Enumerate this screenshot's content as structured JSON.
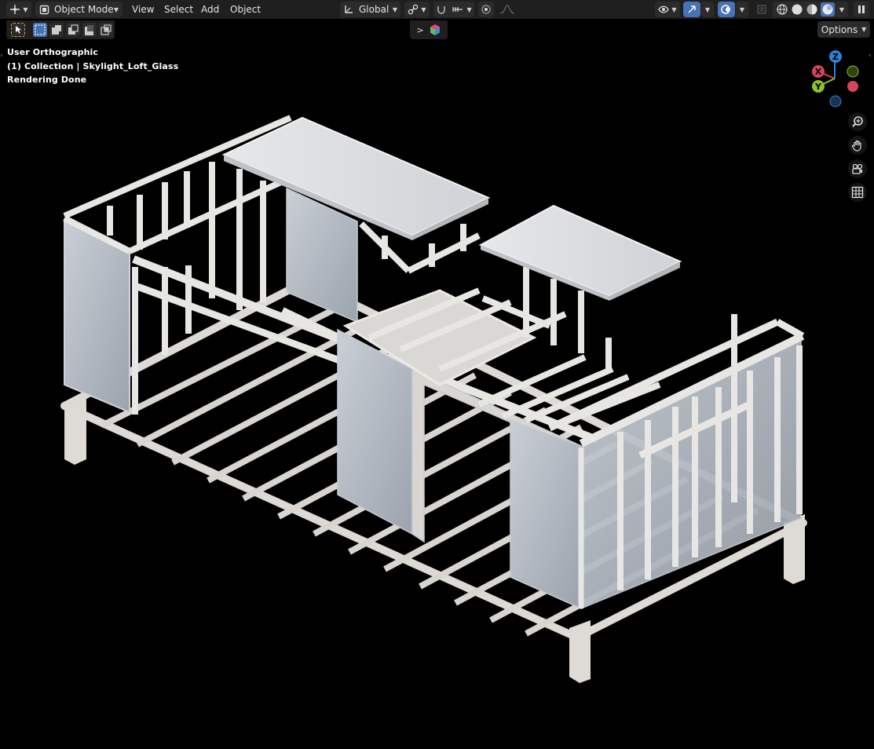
{
  "header": {
    "mode_label": "Object Mode",
    "menu": [
      "View",
      "Select",
      "Add",
      "Object"
    ],
    "transform_orientation": "Global",
    "options_label": "Options"
  },
  "viewport": {
    "view_name": "User Orthographic",
    "collection_info": "(1) Collection | Skylight_Loft_Glass",
    "render_status": "Rendering Done"
  },
  "gizmo": {
    "x_label": "X",
    "y_label": "Y",
    "z_label": "Z",
    "x_color": "#d5455b",
    "y_color": "#8bc22c",
    "z_color": "#2c82d6"
  },
  "nav_tools": [
    "zoom-icon",
    "hand-pan-icon",
    "camera-icon",
    "grid-icon"
  ],
  "colors": {
    "accent": "#4772b3",
    "header_bg": "#1f1f1f",
    "button_bg": "#2b2b2b",
    "viewport_bg": "#000000",
    "model": "#e4e4e4"
  }
}
